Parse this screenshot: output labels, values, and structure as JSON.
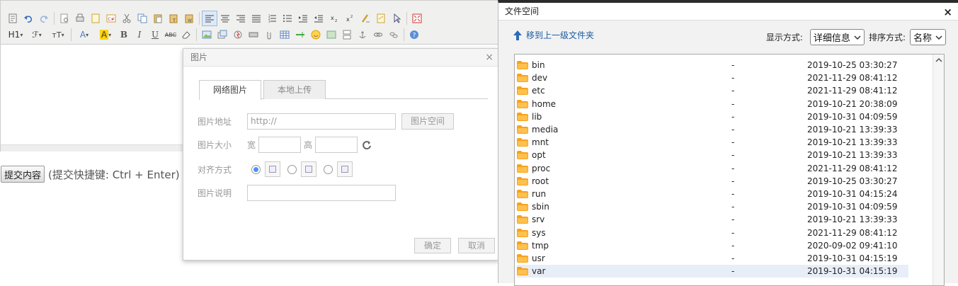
{
  "toolbar": {
    "row1": [
      "source-icon",
      "undo-icon",
      "redo-icon",
      "sep",
      "preview-icon",
      "print-icon",
      "template-icon",
      "code-icon",
      "cut-icon",
      "copy-icon",
      "paste-icon",
      "paste-text-icon",
      "paste-word-icon",
      "sep",
      "align-left-icon",
      "align-center-icon",
      "align-right-icon",
      "justify-icon",
      "ordered-list-icon",
      "unordered-list-icon",
      "indent-icon",
      "outdent-icon",
      "subscript-icon",
      "superscript-icon",
      "clear-format-icon",
      "select-all-icon",
      "pointer-icon",
      "sep",
      "fullscreen-icon"
    ],
    "row2": {
      "heading": "H1",
      "font_name": "ℱ",
      "font_size": "тT",
      "text_color": "A",
      "highlight": "A",
      "bold": "B",
      "italic": "I",
      "underline": "U",
      "strike": "ABC"
    }
  },
  "editor": {
    "submit_label": "提交内容",
    "submit_hint": "(提交快捷键: Ctrl + Enter)"
  },
  "image_dialog": {
    "title": "图片",
    "tabs": [
      "网络图片",
      "本地上传"
    ],
    "url_label": "图片地址",
    "url_placeholder": "http://",
    "space_button": "图片空间",
    "size_label": "图片大小",
    "width_label": "宽",
    "height_label": "高",
    "align_label": "对齐方式",
    "desc_label": "图片说明",
    "ok_button": "确定",
    "cancel_button": "取消"
  },
  "file_space": {
    "title": "文件空间",
    "close": "×",
    "up_link": "移到上一级文件夹",
    "view_label": "显示方式:",
    "view_value": "详细信息",
    "sort_label": "排序方式:",
    "sort_value": "名称",
    "files": [
      {
        "name": "bin",
        "size": "-",
        "date": "2019-10-25 03:30:27"
      },
      {
        "name": "dev",
        "size": "-",
        "date": "2021-11-29 08:41:12"
      },
      {
        "name": "etc",
        "size": "-",
        "date": "2021-11-29 08:41:12"
      },
      {
        "name": "home",
        "size": "-",
        "date": "2019-10-21 20:38:09"
      },
      {
        "name": "lib",
        "size": "-",
        "date": "2019-10-31 04:09:59"
      },
      {
        "name": "media",
        "size": "-",
        "date": "2019-10-21 13:39:33"
      },
      {
        "name": "mnt",
        "size": "-",
        "date": "2019-10-21 13:39:33"
      },
      {
        "name": "opt",
        "size": "-",
        "date": "2019-10-21 13:39:33"
      },
      {
        "name": "proc",
        "size": "-",
        "date": "2021-11-29 08:41:12"
      },
      {
        "name": "root",
        "size": "-",
        "date": "2019-10-25 03:30:27"
      },
      {
        "name": "run",
        "size": "-",
        "date": "2019-10-31 04:15:24"
      },
      {
        "name": "sbin",
        "size": "-",
        "date": "2019-10-31 04:09:59"
      },
      {
        "name": "srv",
        "size": "-",
        "date": "2019-10-21 13:39:33"
      },
      {
        "name": "sys",
        "size": "-",
        "date": "2021-11-29 08:41:12"
      },
      {
        "name": "tmp",
        "size": "-",
        "date": "2020-09-02 09:41:10"
      },
      {
        "name": "usr",
        "size": "-",
        "date": "2019-10-31 04:15:19"
      },
      {
        "name": "var",
        "size": "-",
        "date": "2019-10-31 04:15:19"
      }
    ],
    "selected_index": 16,
    "colors": {
      "folder": "#f7a21b",
      "link": "#1a5c9e",
      "selected_row": "#e8eef7"
    }
  }
}
